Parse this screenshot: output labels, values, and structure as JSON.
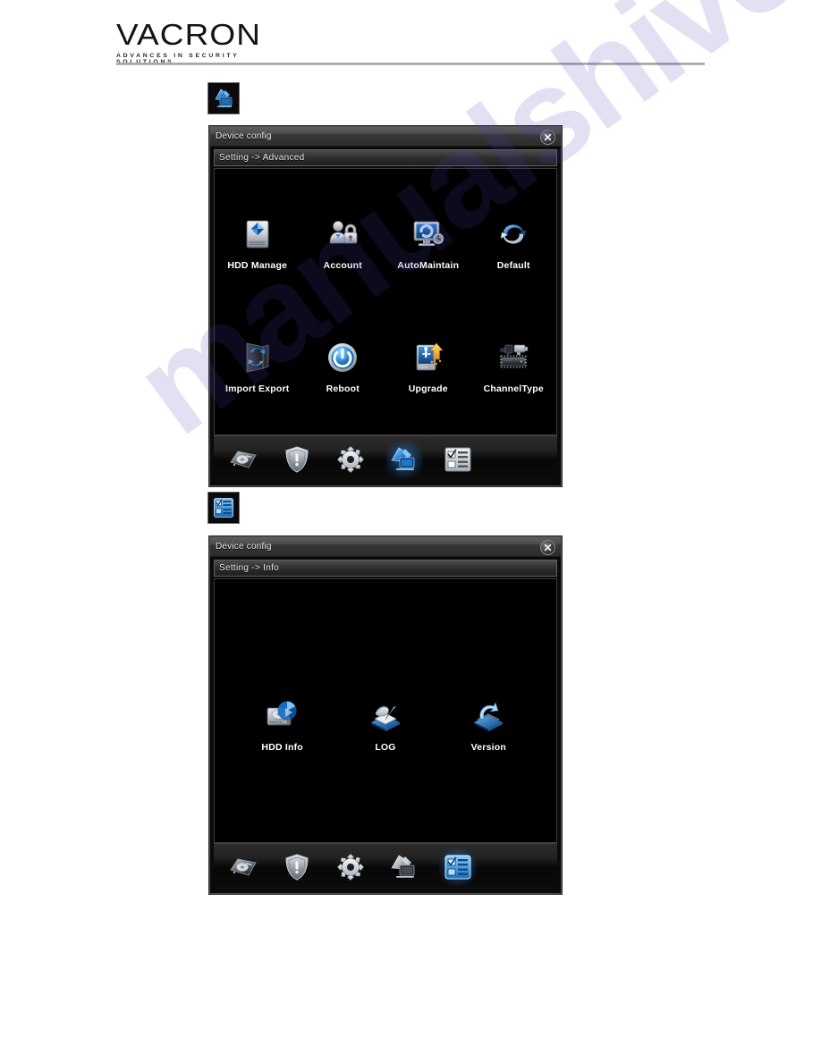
{
  "brand": {
    "name": "VACRON",
    "tagline": "ADVANCES IN SECURITY SOLUTIONS"
  },
  "watermark": {
    "text": "manualshive.com",
    "color": "#4646b4"
  },
  "launchers": [
    {
      "name": "advanced-launcher-icon",
      "icon": "advanced-icon",
      "tooltip": "Advanced"
    },
    {
      "name": "info-launcher-icon",
      "icon": "info-icon",
      "tooltip": "Info"
    }
  ],
  "dialogs": [
    {
      "title": "Device config",
      "breadcrumb": "Setting -> Advanced",
      "close_label": "✕",
      "items": [
        {
          "label": "HDD Manage",
          "icon": "hdd-manage-icon"
        },
        {
          "label": "Account",
          "icon": "account-icon"
        },
        {
          "label": "AutoMaintain",
          "icon": "auto-maintain-icon"
        },
        {
          "label": "Default",
          "icon": "default-icon"
        },
        {
          "label": "Import Export",
          "icon": "import-export-icon"
        },
        {
          "label": "Reboot",
          "icon": "reboot-icon"
        },
        {
          "label": "Upgrade",
          "icon": "upgrade-icon"
        },
        {
          "label": "ChannelType",
          "icon": "channel-type-icon"
        }
      ],
      "toolbar": [
        {
          "name": "record-tab",
          "icon": "hdd-icon",
          "active": false
        },
        {
          "name": "alarm-tab",
          "icon": "shield-icon",
          "active": false
        },
        {
          "name": "system-tab",
          "icon": "gear-icon",
          "active": false
        },
        {
          "name": "advanced-tab",
          "icon": "advanced-icon",
          "active": true
        },
        {
          "name": "info-tab",
          "icon": "info-icon",
          "active": false
        }
      ]
    },
    {
      "title": "Device config",
      "breadcrumb": "Setting -> Info",
      "close_label": "✕",
      "items": [
        {
          "label": "HDD Info",
          "icon": "hdd-info-icon"
        },
        {
          "label": "LOG",
          "icon": "log-icon"
        },
        {
          "label": "Version",
          "icon": "version-icon"
        }
      ],
      "toolbar": [
        {
          "name": "record-tab",
          "icon": "hdd-icon",
          "active": false
        },
        {
          "name": "alarm-tab",
          "icon": "shield-icon",
          "active": false
        },
        {
          "name": "system-tab",
          "icon": "gear-icon",
          "active": false
        },
        {
          "name": "advanced-tab",
          "icon": "advanced-icon",
          "active": false
        },
        {
          "name": "info-tab",
          "icon": "info-icon",
          "active": true
        }
      ]
    }
  ]
}
